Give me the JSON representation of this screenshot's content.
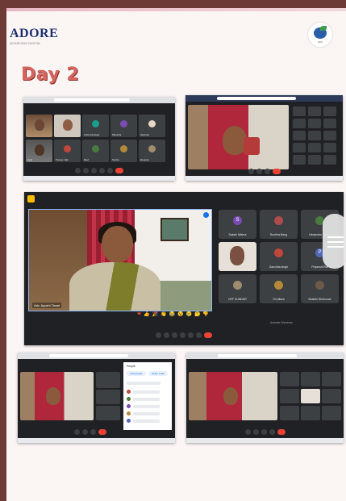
{
  "header": {
    "logo_left_text": "ADORE",
    "logo_left_sub": "ACHIEVING DIGITAL",
    "logo_right_caption": "GKA",
    "title": "Day 2"
  },
  "colors": {
    "border": "#6e3a36",
    "page_bg": "#fbf5f4",
    "title": "#d5655f",
    "meet_bg": "#202124",
    "tile_bg": "#3c4043",
    "end_call": "#ea4335"
  },
  "screenshots": [
    {
      "id": "shot-1",
      "kind": "google-meet-grid",
      "names": [
        "",
        "",
        "Anita Kashyap",
        "Manisha",
        "Santosh",
        "Jyoti",
        "Puneet Jain",
        "Ravi",
        "Sunita",
        "Deepak"
      ]
    },
    {
      "id": "shot-2",
      "kind": "google-meet-speaker-with-grid"
    },
    {
      "id": "shot-3",
      "kind": "google-meet-speaker-main",
      "speaker_name": "Adv. Ayushi Tiwari",
      "participants": [
        {
          "name": "Sakshi Mishra",
          "initial": "S",
          "color": "#7b4bb4"
        },
        {
          "name": "Ruchira Bang",
          "initial": "",
          "color": "#b04b4b"
        },
        {
          "name": "Himanshu Bhal...",
          "initial": "",
          "color": "#4a7a3d"
        },
        {
          "name": "",
          "initial": "",
          "color": ""
        },
        {
          "name": "Sanchita singh",
          "initial": "",
          "color": "#c0463a"
        },
        {
          "name": "Priyanshi Rai",
          "initial": "P",
          "color": "#5466b8"
        },
        {
          "name": "NFF SUNDAR",
          "initial": "",
          "color": "#9e8c6d"
        },
        {
          "name": "Sri aftara",
          "initial": "",
          "color": "#b48a3a"
        },
        {
          "name": "Shakthi Shrikumar",
          "initial": "",
          "color": "#6d5a4a"
        }
      ],
      "reactions": [
        "❤",
        "👍",
        "🎉",
        "👏",
        "😂",
        "😮",
        "😢",
        "🤔",
        "👎"
      ],
      "watermark": "Activate Windows"
    },
    {
      "id": "shot-4",
      "kind": "google-meet-speaker-people-panel",
      "panel_title": "People",
      "panel_buttons": [
        "Add people",
        "Share invite"
      ]
    },
    {
      "id": "shot-5",
      "kind": "google-meet-speaker-with-grid"
    }
  ]
}
